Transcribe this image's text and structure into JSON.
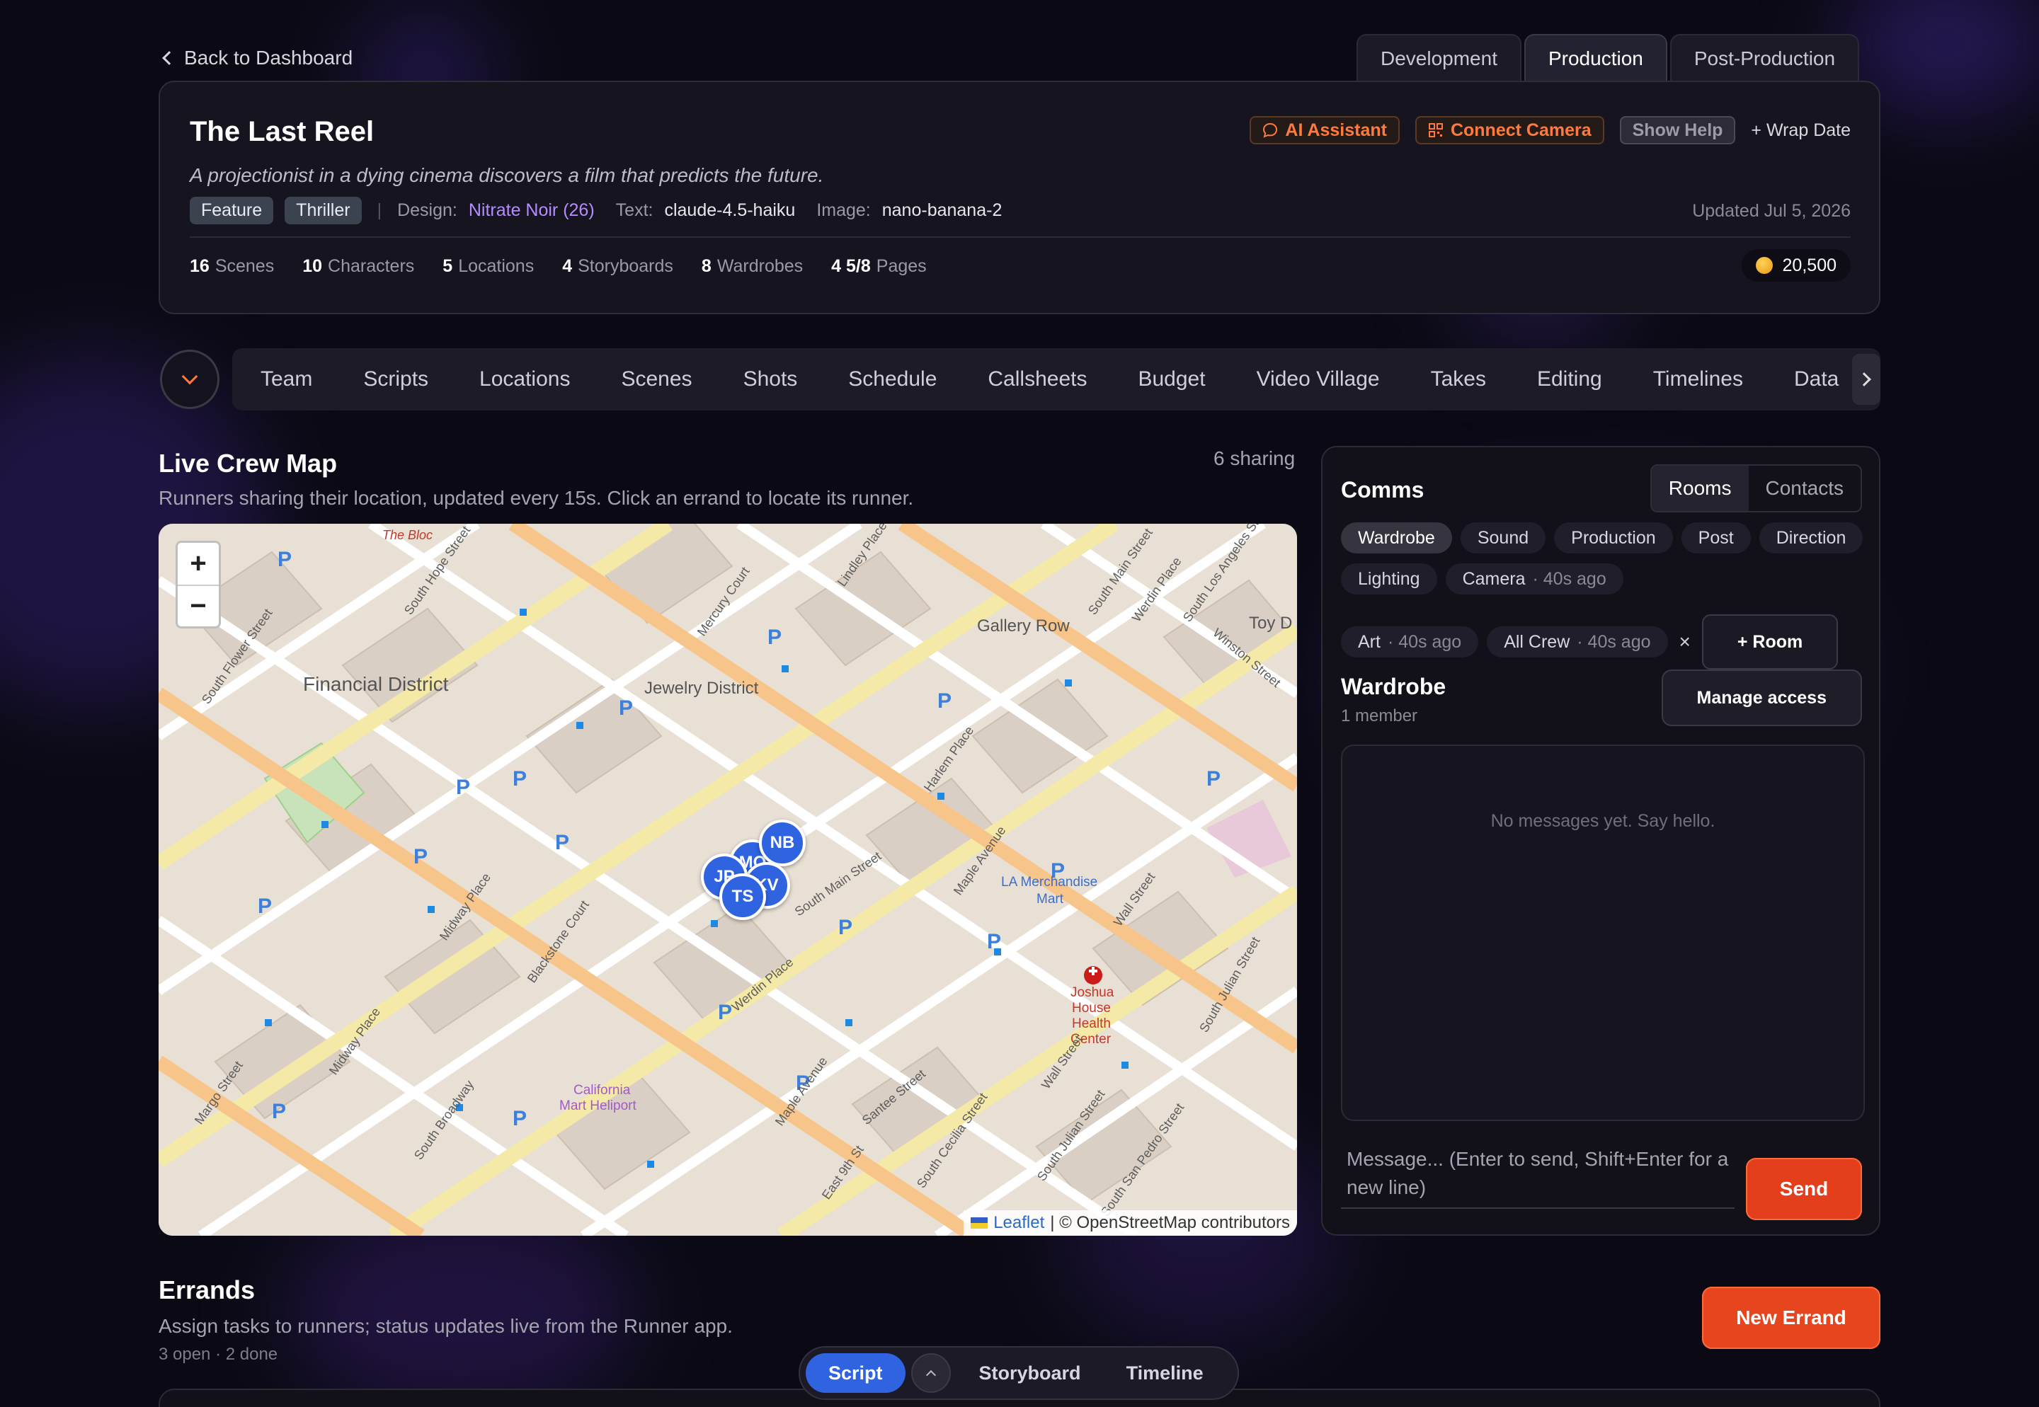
{
  "header": {
    "back_label": "Back to Dashboard",
    "phase_tabs": [
      {
        "label": "Development",
        "active": false
      },
      {
        "label": "Production",
        "active": true
      },
      {
        "label": "Post-Production",
        "active": false
      }
    ]
  },
  "project": {
    "title": "The Last Reel",
    "logline": "A projectionist in a dying cinema discovers a film that predicts the future.",
    "tags": [
      "Feature",
      "Thriller"
    ],
    "design_label": "Design:",
    "design_value": "Nitrate Noir (26)",
    "text_label": "Text:",
    "text_value": "claude-4.5-haiku",
    "image_label": "Image:",
    "image_value": "nano-banana-2",
    "updated": "Updated Jul 5, 2026",
    "actions": {
      "ai_assistant": "AI Assistant",
      "connect_camera": "Connect Camera",
      "show_help": "Show Help",
      "wrap_date": "+ Wrap Date"
    },
    "stats": [
      {
        "value": "16",
        "label": "Scenes"
      },
      {
        "value": "10",
        "label": "Characters"
      },
      {
        "value": "5",
        "label": "Locations"
      },
      {
        "value": "4",
        "label": "Storyboards"
      },
      {
        "value": "8",
        "label": "Wardrobes"
      },
      {
        "value": "4 5/8",
        "label": "Pages"
      }
    ],
    "credits": "20,500"
  },
  "nav": {
    "items": [
      "Team",
      "Scripts",
      "Locations",
      "Scenes",
      "Shots",
      "Schedule",
      "Callsheets",
      "Budget",
      "Video Village",
      "Takes",
      "Editing",
      "Timelines",
      "Data"
    ]
  },
  "crew_map": {
    "title": "Live Crew Map",
    "subtitle": "Runners sharing their location, updated every 15s. Click an errand to locate its runner.",
    "sharing": "6 sharing",
    "zoom_in": "+",
    "zoom_out": "−",
    "attribution_leaflet": "Leaflet",
    "attribution_rest": "| © OpenStreetMap contributors",
    "labels": {
      "financial_district": "Financial District",
      "jewelry_district": "Jewelry District",
      "gallery_row": "Gallery Row",
      "toy_d": "Toy D",
      "the_bloc": "The Bloc",
      "la_merchandise_mart_1": "LA Merchandise",
      "la_merchandise_mart_2": "Mart",
      "joshua_1": "Joshua",
      "joshua_2": "House",
      "joshua_3": "Health",
      "joshua_4": "Center",
      "heliport_1": "California",
      "heliport_2": "Mart Heliport",
      "south_main": "South Main Street",
      "south_flower": "South Flower Street",
      "south_hope": "South Hope Street",
      "south_broadway": "South Broadway",
      "maple_ave": "Maple Avenue",
      "wall_st": "Wall Street",
      "santee_st": "Santee Street",
      "south_los_angeles": "South Los Angeles St",
      "winston_st": "Winston Street",
      "harlem_place": "Harlem Place",
      "werdin_place": "Werdin Place",
      "mercury_court": "Mercury Court",
      "lindley_place": "Lindley Place",
      "midway_place": "Midway Place",
      "blackstone_court": "Blackstone Court",
      "margo_st": "Margo Street",
      "south_julian": "South Julian Street",
      "san_pedro": "South San Pedro Street",
      "south_cecilia": "South Cecilia Street",
      "east_9th": "East 9th St"
    },
    "markers": [
      "NB",
      "MO",
      "JP",
      "KV",
      "TS"
    ]
  },
  "comms": {
    "title": "Comms",
    "tabs": [
      {
        "label": "Rooms",
        "active": true
      },
      {
        "label": "Contacts",
        "active": false
      }
    ],
    "rooms": [
      {
        "label": "Wardrobe",
        "ago": "",
        "active": true
      },
      {
        "label": "Sound",
        "ago": ""
      },
      {
        "label": "Production",
        "ago": ""
      },
      {
        "label": "Post",
        "ago": ""
      },
      {
        "label": "Direction",
        "ago": ""
      },
      {
        "label": "Lighting",
        "ago": ""
      },
      {
        "label": "Camera",
        "ago": "· 40s ago"
      },
      {
        "label": "Art",
        "ago": "· 40s ago"
      },
      {
        "label": "All Crew",
        "ago": "· 40s ago"
      }
    ],
    "remove_label": "×",
    "add_room": "+ Room",
    "channel_name": "Wardrobe",
    "channel_members": "1 member",
    "manage_access": "Manage access",
    "empty_message": "No messages yet. Say hello.",
    "compose_placeholder": "Message... (Enter to send, Shift+Enter for a new line)",
    "send": "Send"
  },
  "errands": {
    "title": "Errands",
    "subtitle": "Assign tasks to runners; status updates live from the Runner app.",
    "count": "3 open · 2 done",
    "new_button": "New Errand"
  },
  "dock": {
    "items": [
      {
        "label": "Script",
        "active": true
      },
      {
        "label": "Storyboard"
      },
      {
        "label": "Timeline"
      }
    ]
  }
}
